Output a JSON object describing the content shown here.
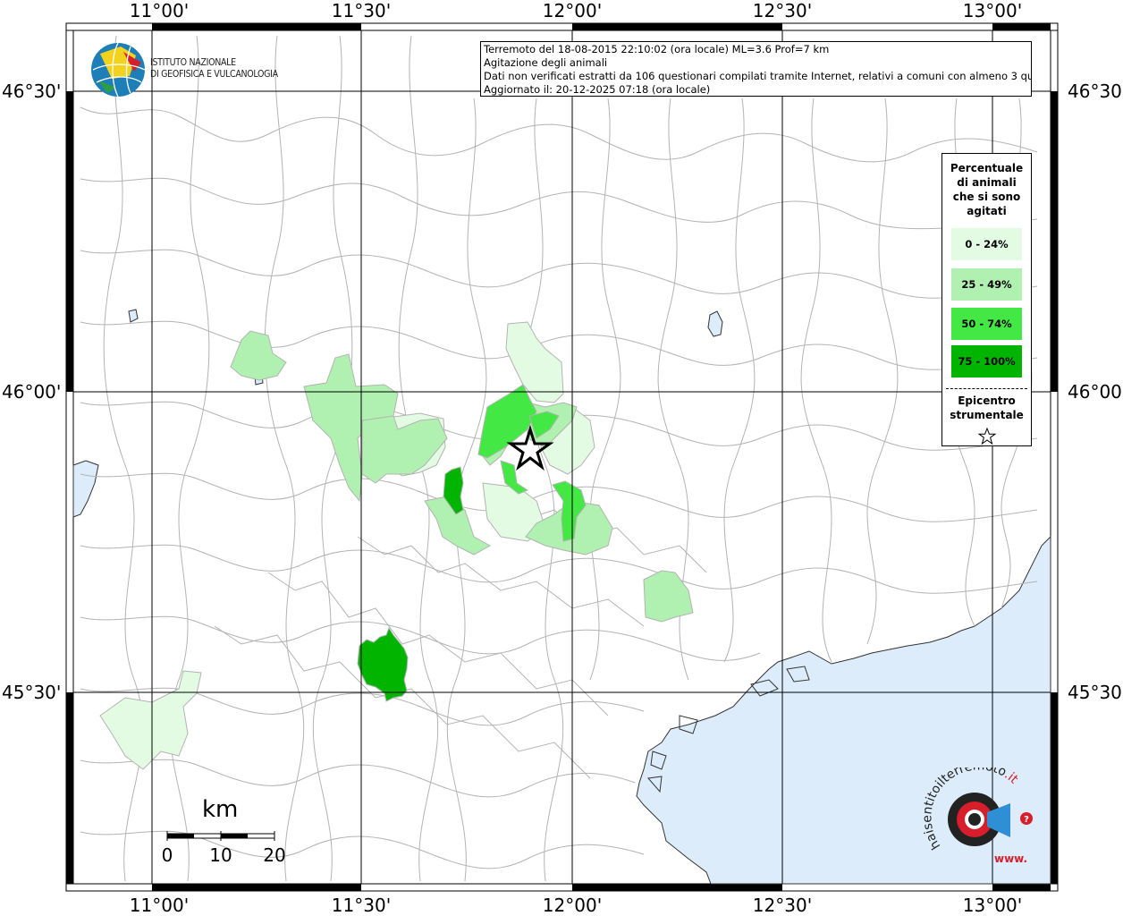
{
  "map": {
    "top_lon_labels": [
      "11°00'",
      "11°30'",
      "12°00'",
      "12°30'",
      "13°00'"
    ],
    "bottom_lon_labels": [
      "11°00'",
      "11°30'",
      "12°00'",
      "12°30'",
      "13°00'"
    ],
    "left_lat_labels": [
      "46°30'",
      "46°00'",
      "45°30'"
    ],
    "right_lat_labels": [
      "46°30'",
      "46°00'",
      "45°30'"
    ],
    "colors": {
      "land": "#ffffff",
      "sea": "#dcecfa",
      "borders": "#b3b3b3",
      "grid": "#000000",
      "class_0_24": "#e2fbe2",
      "class_25_49": "#b0f0b0",
      "class_50_74": "#44e844",
      "class_75_100": "#00b400"
    }
  },
  "logo": {
    "line1": "ISTITUTO NAZIONALE",
    "line2": "DI GEOFISICA E VULCANOLOGIA"
  },
  "info": {
    "line1": "Terremoto del 18-08-2015 22:10:02 (ora locale) ML=3.6 Prof=7 km",
    "line2": "Agitazione degli animali",
    "line3": "Dati non verificati estratti da 106 questionari compilati tramite Internet, relativi a comuni con almeno 3 questionari.",
    "line4": "Aggiornato il: 20-12-2025 07:18 (ora locale)"
  },
  "legend": {
    "title_lines": [
      "Percentuale",
      "di animali",
      "che si sono",
      "agitati"
    ],
    "classes": [
      {
        "label": "0 - 24%",
        "color": "#e2fbe2"
      },
      {
        "label": "25 - 49%",
        "color": "#b0f0b0"
      },
      {
        "label": "50 - 74%",
        "color": "#44e844"
      },
      {
        "label": "75 - 100%",
        "color": "#00b400"
      }
    ],
    "epicentre_lines": [
      "Epicentro",
      "strumentale"
    ]
  },
  "scale": {
    "unit": "km",
    "ticks": [
      "0",
      "10",
      "20"
    ]
  },
  "hst_logo": {
    "text_main": "haisentitoilterremoto",
    "text_suffix": ".it",
    "text_www": "www."
  }
}
